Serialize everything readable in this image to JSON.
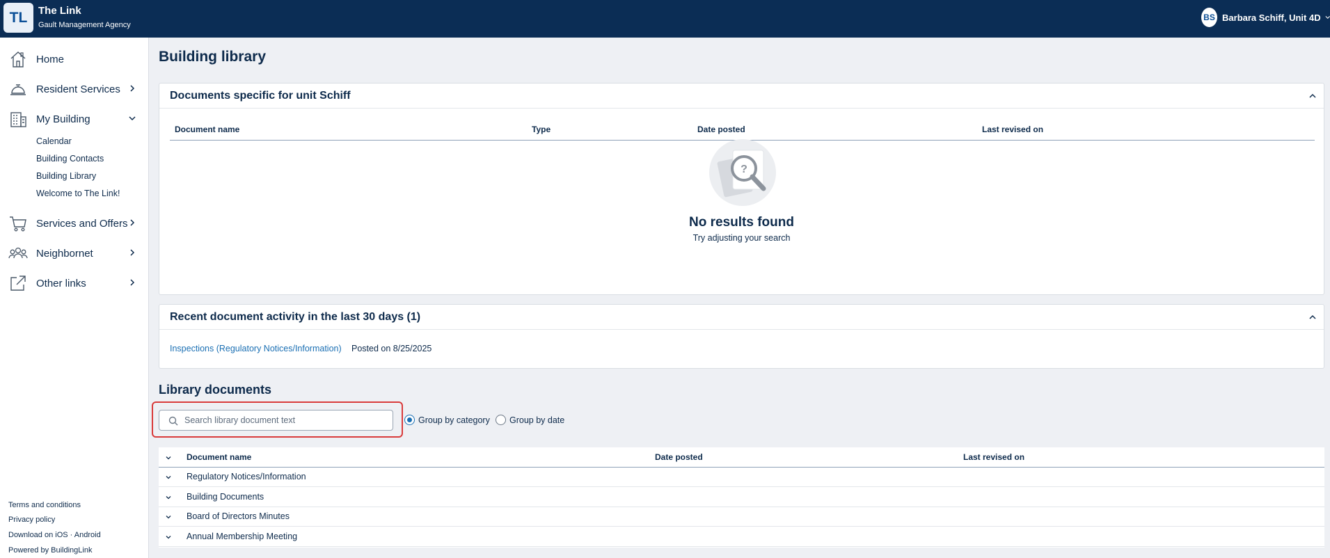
{
  "header": {
    "logo": "TL",
    "app_title": "The Link",
    "agency": "Gault Management Agency",
    "user_initials": "BS",
    "user_name": "Barbara Schiff, Unit 4D"
  },
  "sidebar": {
    "items": [
      {
        "label": "Home",
        "icon": "home-icon"
      },
      {
        "label": "Resident Services",
        "icon": "concierge-bell-icon"
      },
      {
        "label": "My Building",
        "icon": "building-icon"
      },
      {
        "label": "Services and Offers",
        "icon": "cart-icon"
      },
      {
        "label": "Neighbornet",
        "icon": "people-icon"
      },
      {
        "label": "Other links",
        "icon": "external-link-icon"
      }
    ],
    "sub_items": [
      "Calendar",
      "Building Contacts",
      "Building Library",
      "Welcome to The Link!"
    ],
    "footer_links": [
      "Terms and conditions",
      "Privacy policy",
      "Download on iOS · Android",
      "Powered by BuildingLink"
    ]
  },
  "main": {
    "page_title": "Building library",
    "unit_docs": {
      "title": "Documents specific for unit Schiff",
      "columns": [
        "Document name",
        "Type",
        "Date posted",
        "Last revised on"
      ],
      "empty_title": "No results found",
      "empty_subtitle": "Try adjusting your search"
    },
    "recent_activity": {
      "title": "Recent document activity in the last 30 days (1)",
      "link": "Inspections (Regulatory Notices/Information)",
      "posted": "Posted on 8/25/2025"
    },
    "library": {
      "title": "Library documents",
      "search_placeholder": "Search library document text",
      "group_by_category": "Group by category",
      "group_by_date": "Group by date",
      "selected_grouping": "Group by category",
      "columns": [
        "Document name",
        "Date posted",
        "Last revised on"
      ],
      "categories": [
        "Regulatory Notices/Information",
        "Building Documents",
        "Board of Directors Minutes",
        "Annual Membership Meeting"
      ]
    }
  },
  "colors": {
    "topbar": "#0b2d55",
    "accent": "#1a6fb3",
    "highlight": "#d93b3b"
  }
}
